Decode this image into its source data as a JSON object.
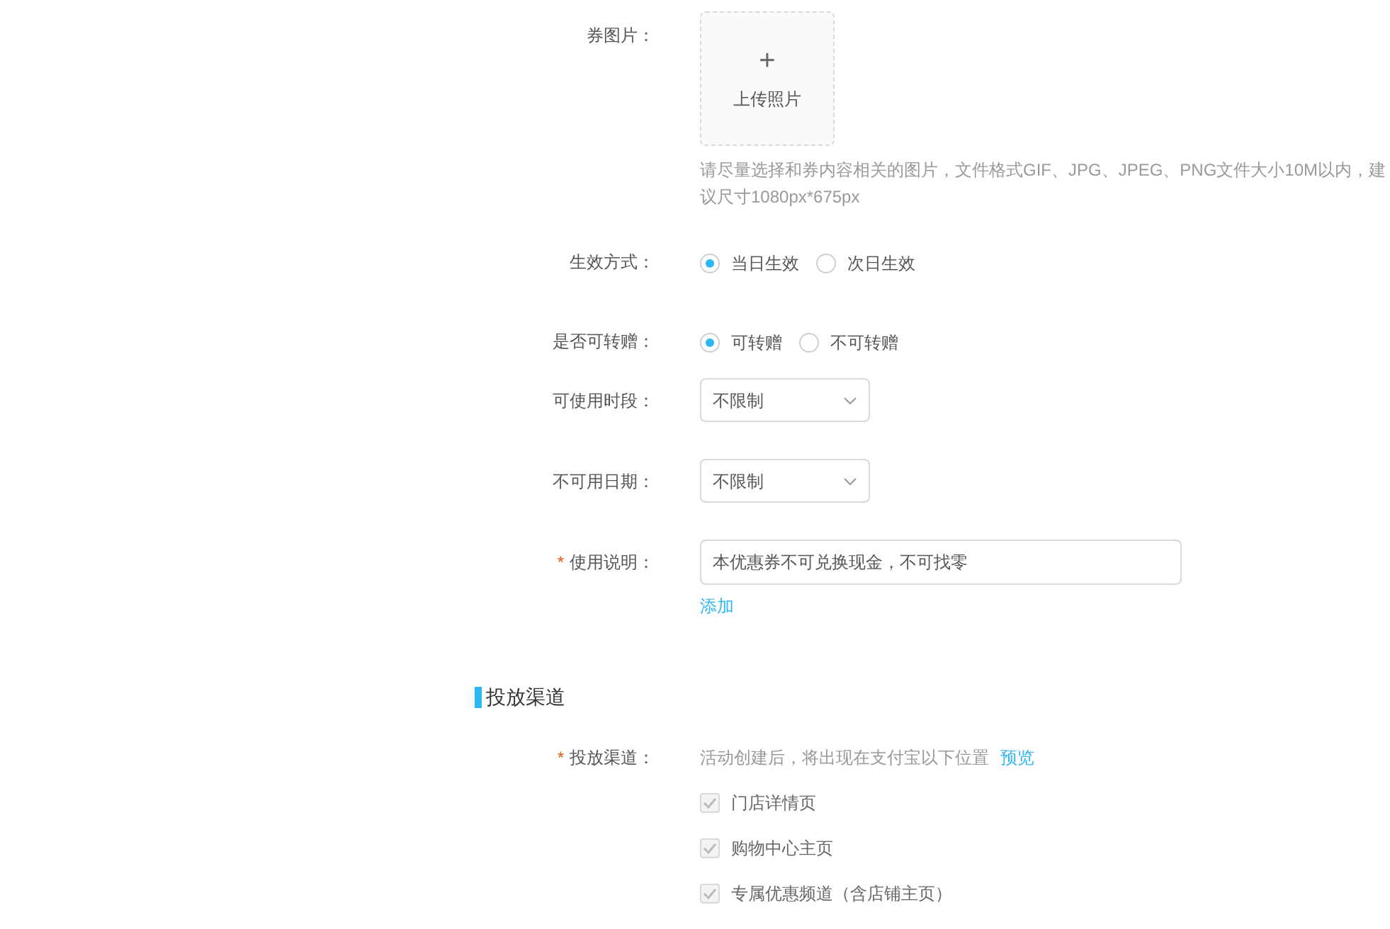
{
  "image_field": {
    "label": "券图片：",
    "upload_icon": "+",
    "upload_text": "上传照片",
    "hint": "请尽量选择和券内容相关的图片，文件格式GIF、JPG、JPEG、PNG文件大小10M以内，建议尺寸1080px*675px"
  },
  "effective": {
    "label": "生效方式：",
    "options": [
      {
        "label": "当日生效",
        "selected": true
      },
      {
        "label": "次日生效",
        "selected": false
      }
    ]
  },
  "transferable": {
    "label": "是否可转赠：",
    "options": [
      {
        "label": "可转赠",
        "selected": true
      },
      {
        "label": "不可转赠",
        "selected": false
      }
    ]
  },
  "usable_time": {
    "label": "可使用时段：",
    "value": "不限制"
  },
  "unusable_date": {
    "label": "不可用日期：",
    "value": "不限制"
  },
  "usage_note": {
    "label": "使用说明：",
    "required_mark": "*",
    "value": "本优惠券不可兑换现金，不可找零",
    "add_link": "添加"
  },
  "section": {
    "title": "投放渠道"
  },
  "channel": {
    "label": "投放渠道：",
    "required_mark": "*",
    "description": "活动创建后，将出现在支付宝以下位置",
    "preview_link": "预览",
    "options": [
      {
        "label": "门店详情页",
        "checked": true,
        "disabled": true
      },
      {
        "label": "购物中心主页",
        "checked": true,
        "disabled": true
      },
      {
        "label": "专属优惠频道（含店铺主页）",
        "checked": true,
        "disabled": true
      }
    ]
  }
}
